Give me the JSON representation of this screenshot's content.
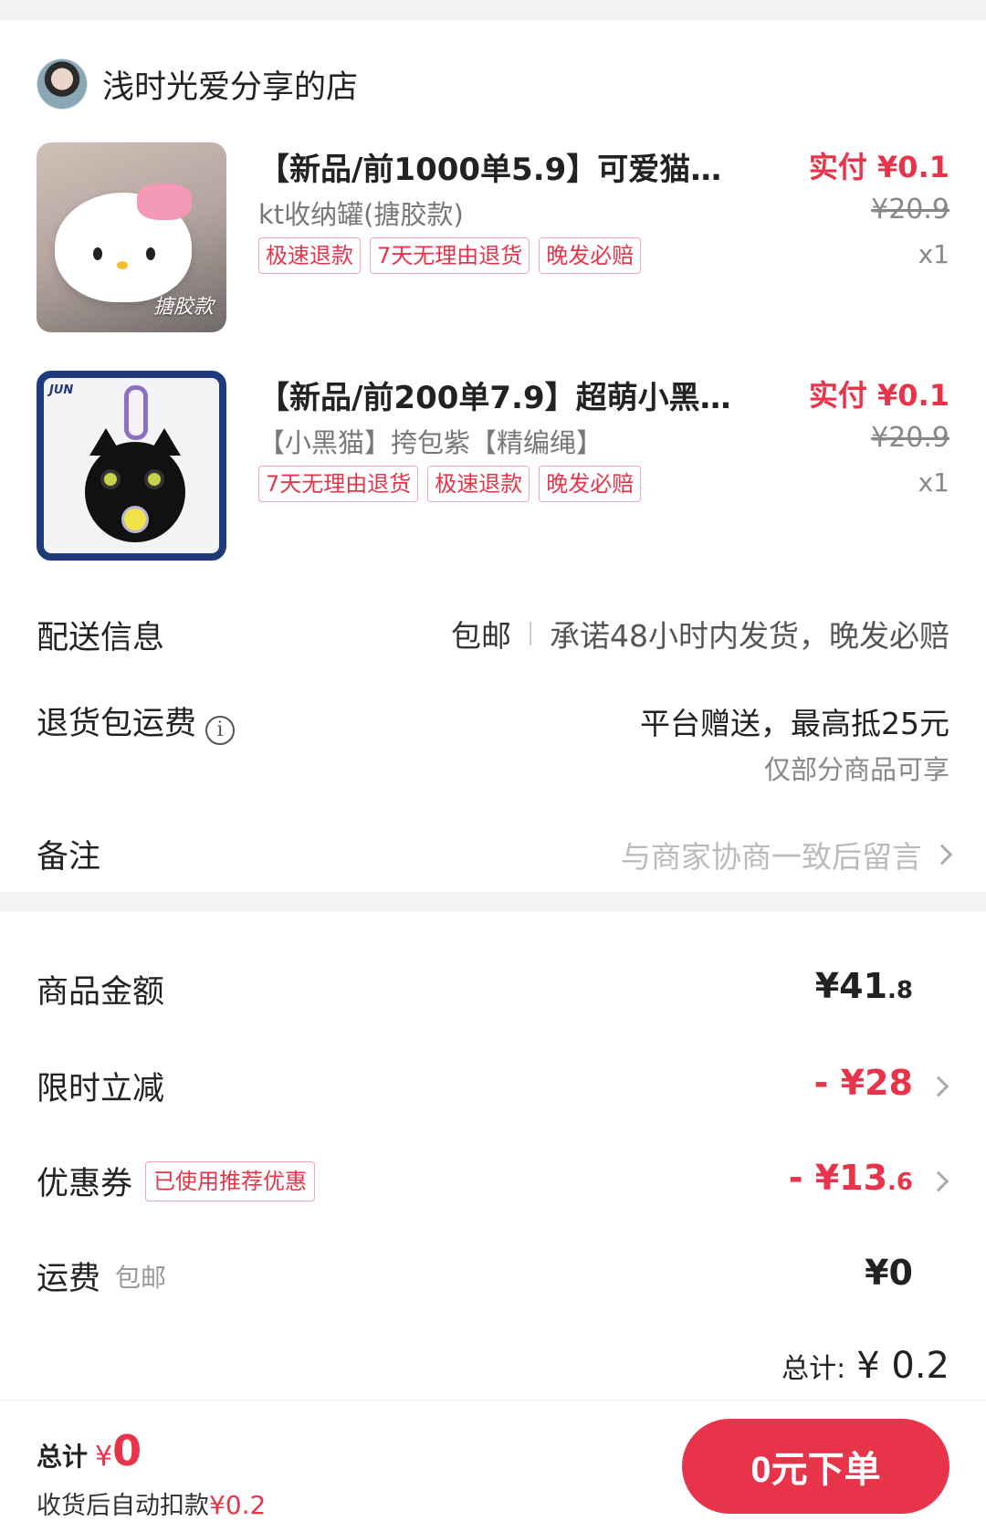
{
  "shop": {
    "name": "浅时光爱分享的店"
  },
  "items": [
    {
      "title": "【新品/前1000单5.9】可爱猫…",
      "spec": "kt收纳罐(搪胶款)",
      "tags": [
        "极速退款",
        "7天无理由退货",
        "晚发必赔"
      ],
      "price": "实付 ¥0.1",
      "original_price": "¥20.9",
      "qty": "x1",
      "thumb_caption": "搪胶款"
    },
    {
      "title": "【新品/前200单7.9】超萌小黑…",
      "spec": "【小黑猫】挎包紫【精编绳】",
      "tags": [
        "7天无理由退货",
        "极速退款",
        "晚发必赔"
      ],
      "price": "实付 ¥0.1",
      "original_price": "¥20.9",
      "qty": "x1",
      "thumb_caption": "JUN"
    }
  ],
  "delivery": {
    "label": "配送信息",
    "free": "包邮",
    "promise": "承诺48小时内发货，晚发必赔"
  },
  "return_shipping": {
    "label": "退货包运费",
    "main": "平台赠送，最高抵25元",
    "sub": "仅部分商品可享"
  },
  "remark": {
    "label": "备注",
    "placeholder": "与商家协商一致后留言"
  },
  "summary": {
    "goods_label": "商品金额",
    "goods_int": "¥41",
    "goods_dec": ".8",
    "discount_label": "限时立减",
    "discount_value": "- ¥28",
    "coupon_label": "优惠券",
    "coupon_tag": "已使用推荐优惠",
    "coupon_int": "- ¥13",
    "coupon_dec": ".6",
    "freight_label": "运费",
    "freight_sub": "包邮",
    "freight_value": "¥0",
    "total_label": "总计:",
    "total_value": "¥ 0.2"
  },
  "footer": {
    "total_label": "总计",
    "currency": "¥",
    "total_amount": "0",
    "auto_deduct_label": "收货后自动扣款",
    "auto_deduct_value": "¥0.2",
    "order_button": "0元下单"
  },
  "colors": {
    "accent": "#e8344a",
    "background": "#f3f3f3"
  }
}
